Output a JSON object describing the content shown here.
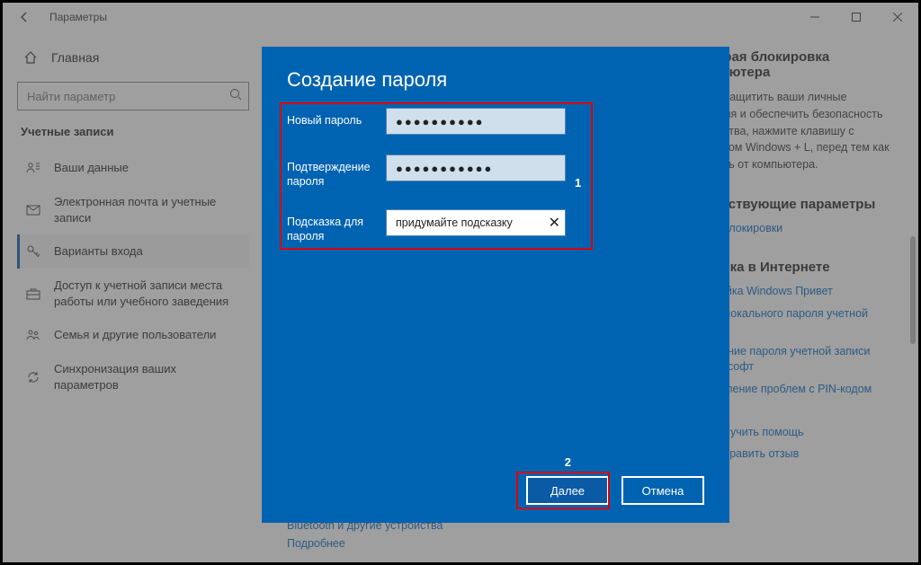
{
  "window": {
    "title": "Параметры"
  },
  "sidebar": {
    "home": "Главная",
    "search_placeholder": "Найти параметр",
    "section": "Учетные записи",
    "items": [
      {
        "label": "Ваши данные"
      },
      {
        "label": "Электронная почта и учетные записи"
      },
      {
        "label": "Варианты входа"
      },
      {
        "label": "Доступ к учетной записи места работы или учебного заведения"
      },
      {
        "label": "Семья и другие пользователи"
      },
      {
        "label": "Синхронизация ваших параметров"
      }
    ]
  },
  "rightpane": {
    "lock_title": "Быстрая блокировка компьютера",
    "lock_text": "Чтобы защитить ваши личные сведения и обеспечить безопасность устройства, нажмите клавишу с логотипом Windows + L, перед тем как отходить от компьютера.",
    "related_title": "Сопутствующие параметры",
    "related_link": "Экран блокировки",
    "web_title": "Справка в Интернете",
    "web_links": [
      "Настройка Windows Привет",
      "Сброс локального пароля учетной записи",
      "Изменение пароля учетной записи Майкрософт",
      "Исправление проблем с PIN-кодом"
    ],
    "help": "Получить помощь",
    "feedback": "Отправить отзыв"
  },
  "bottom_links": {
    "bt": "Bluetooth и другие устройства",
    "more": "Подробнее"
  },
  "dialog": {
    "title": "Создание пароля",
    "new_pw_label": "Новый пароль",
    "confirm_label": "Подтверждение пароля",
    "hint_label": "Подсказка для пароля",
    "new_pw_value": "●●●●●●●●●●",
    "confirm_value": "●●●●●●●●●●●",
    "hint_value": "придумайте подсказку",
    "next": "Далее",
    "cancel": "Отмена",
    "anno1": "1",
    "anno2": "2"
  }
}
